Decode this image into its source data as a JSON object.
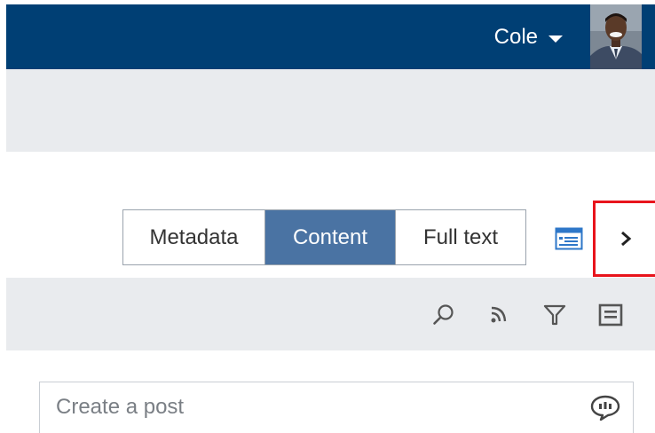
{
  "header": {
    "user_name": "Cole",
    "background_color": "#003f74",
    "avatar_icon": "user-photo"
  },
  "view_switcher": {
    "tabs": [
      {
        "label": "Metadata",
        "selected": false
      },
      {
        "label": "Content",
        "selected": true
      },
      {
        "label": "Full text",
        "selected": false
      }
    ],
    "selected_color": "#4a73a3"
  },
  "view_controls": {
    "card_view_icon": "card-view-icon",
    "expand_icon": "chevron-right-icon",
    "highlight_color": "#e8141c"
  },
  "toolbar": {
    "icons": [
      "search-icon",
      "rss-feed-icon",
      "filter-icon",
      "list-view-icon"
    ]
  },
  "feed": {
    "create_post_placeholder": "Create a post",
    "post_icon": "speech-bubble-icon"
  }
}
